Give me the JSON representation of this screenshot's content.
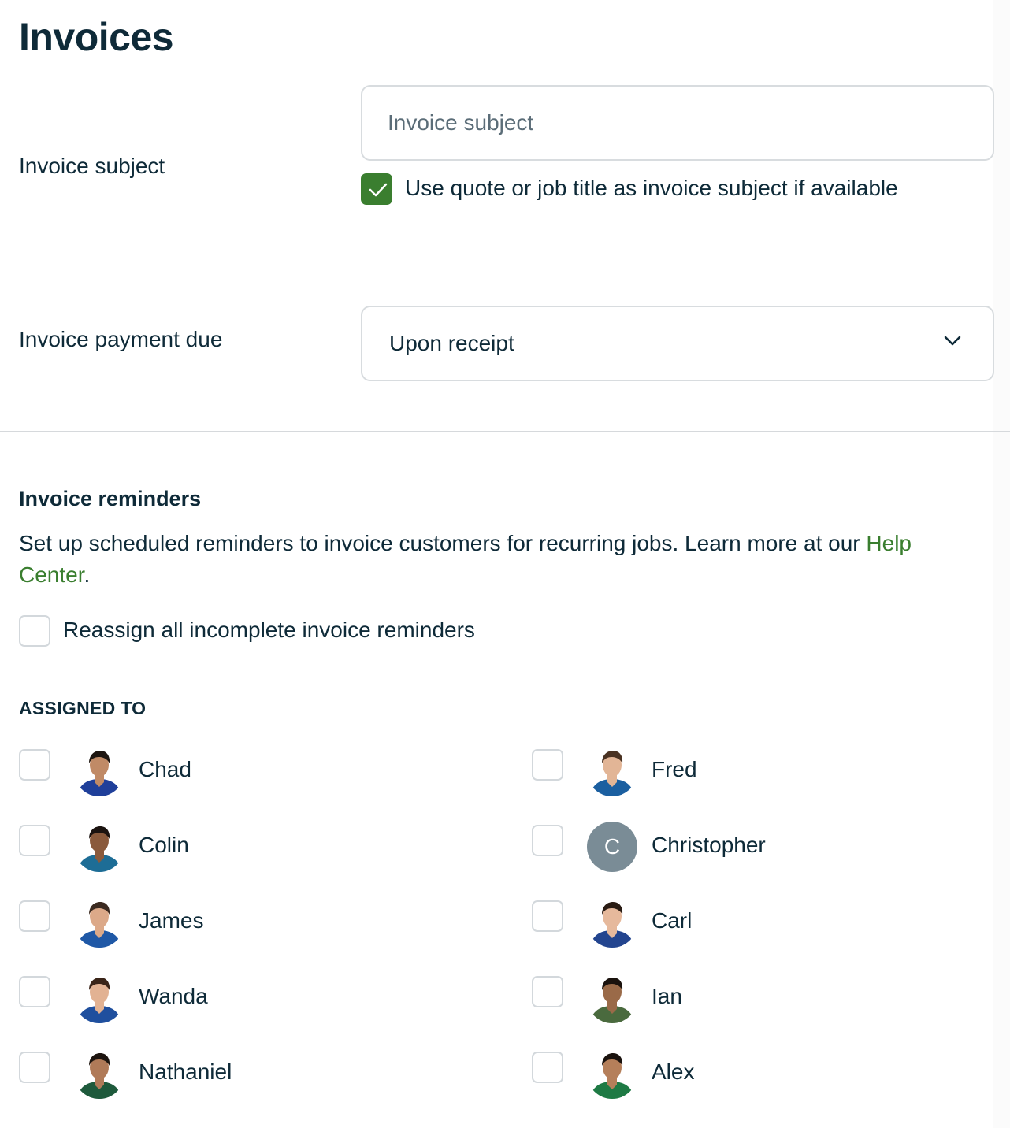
{
  "page": {
    "title": "Invoices"
  },
  "invoice_subject": {
    "label": "Invoice subject",
    "placeholder": "Invoice subject",
    "value": "",
    "use_title_checkbox": {
      "label": "Use quote or job title as invoice subject if available",
      "checked": true
    }
  },
  "payment_due": {
    "label": "Invoice payment due",
    "selected": "Upon receipt"
  },
  "reminders": {
    "title": "Invoice reminders",
    "description": "Set up scheduled reminders to invoice customers for recurring jobs. Learn more at our ",
    "help_link": "Help Center",
    "description_end": ".",
    "reassign_checkbox": {
      "label": "Reassign all incomplete invoice reminders",
      "checked": false
    }
  },
  "assigned_to": {
    "heading": "ASSIGNED TO",
    "people": [
      {
        "name": "Chad",
        "checked": false,
        "avatar": "photo",
        "shirt": "#1f3f9a",
        "skin": "#c08a66",
        "hair": "#1d1510"
      },
      {
        "name": "Fred",
        "checked": false,
        "avatar": "photo",
        "shirt": "#1b5fa0",
        "skin": "#e2b596",
        "hair": "#4a3222"
      },
      {
        "name": "Colin",
        "checked": false,
        "avatar": "photo",
        "shirt": "#1d6d96",
        "skin": "#8a5a3c",
        "hair": "#1b1310"
      },
      {
        "name": "Christopher",
        "checked": false,
        "avatar": "initial",
        "initial": "C",
        "avatar_color": "#7a8c96"
      },
      {
        "name": "James",
        "checked": false,
        "avatar": "photo",
        "shirt": "#1f58a6",
        "skin": "#dca989",
        "hair": "#3b2a20"
      },
      {
        "name": "Carl",
        "checked": false,
        "avatar": "photo",
        "shirt": "#23458f",
        "skin": "#e6b99c",
        "hair": "#2a1c14"
      },
      {
        "name": "Wanda",
        "checked": false,
        "avatar": "photo",
        "shirt": "#1f4f9e",
        "skin": "#e2b293",
        "hair": "#3a2418"
      },
      {
        "name": "Ian",
        "checked": false,
        "avatar": "photo",
        "shirt": "#4a6a3e",
        "skin": "#9a6a48",
        "hair": "#1a120d"
      },
      {
        "name": "Nathaniel",
        "checked": false,
        "avatar": "photo",
        "shirt": "#1e5a3c",
        "skin": "#b07a58",
        "hair": "#1c140f"
      },
      {
        "name": "Alex",
        "checked": false,
        "avatar": "photo",
        "shirt": "#1e7a44",
        "skin": "#b57f5a",
        "hair": "#1a120e"
      }
    ]
  },
  "colors": {
    "brand_green": "#3a7e2f",
    "text": "#0e2a38",
    "border": "#d8dcdf"
  }
}
